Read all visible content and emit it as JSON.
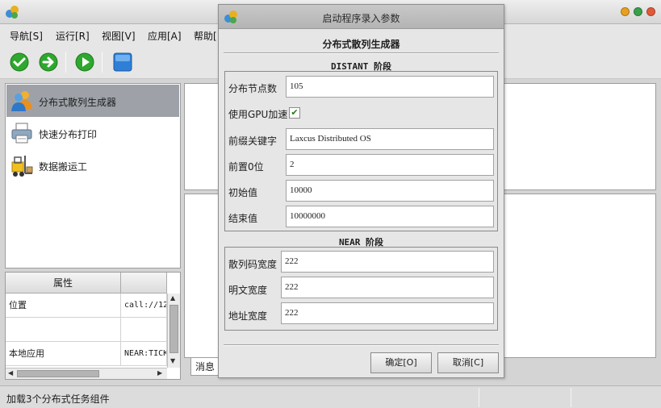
{
  "window": {
    "title": ""
  },
  "menu": {
    "items": [
      "导航[S]",
      "运行[R]",
      "视图[V]",
      "应用[A]",
      "帮助["
    ]
  },
  "toolbar": {
    "buttons": [
      "check-icon",
      "arrow-right-icon",
      "play-icon",
      "square-icon"
    ]
  },
  "sidebar": {
    "items": [
      {
        "label": "分布式散列生成器",
        "icon": "users-icon",
        "selected": true
      },
      {
        "label": "快速分布打印",
        "icon": "printer-icon",
        "selected": false
      },
      {
        "label": "数据搬运工",
        "icon": "forklift-icon",
        "selected": false
      }
    ]
  },
  "properties": {
    "header": "属性",
    "rows": [
      {
        "name": "位置",
        "value": "call://12"
      },
      {
        "name": "",
        "value": ""
      },
      {
        "name": "本地应用",
        "value": "NEAR:TICK"
      }
    ]
  },
  "tabs": {
    "message_label": "消息"
  },
  "status": {
    "text": "加载3个分布式任务组件"
  },
  "dialog": {
    "title": "启动程序录入参数",
    "heading": "分布式散列生成器",
    "distant": {
      "title": "DISTANT 阶段",
      "node_count": {
        "label": "分布节点数",
        "value": "105"
      },
      "gpu": {
        "label": "使用GPU加速",
        "checked": true,
        "mark": "✔"
      },
      "keyword": {
        "label": "前缀关键字",
        "value": "Laxcus Distributed OS"
      },
      "zero": {
        "label": "前置0位",
        "value": "2"
      },
      "begin": {
        "label": "初始值",
        "value": "10000"
      },
      "end": {
        "label": "结束值",
        "value": "10000000"
      }
    },
    "near": {
      "title": "NEAR 阶段",
      "hash_width": {
        "label": "散列码宽度",
        "value": "222"
      },
      "plain_width": {
        "label": "明文宽度",
        "value": "222"
      },
      "addr_width": {
        "label": "地址宽度",
        "value": "222"
      }
    },
    "ok_label": "确定[O]",
    "cancel_label": "取消[C]"
  },
  "colors": {
    "selection": "#9ea2a8",
    "win_close": "#e05a3a",
    "win_max": "#3aa04a",
    "win_min": "#e8a020",
    "toolbar_green": "#2ea82e",
    "toolbar_blue": "#2f7fd6"
  }
}
